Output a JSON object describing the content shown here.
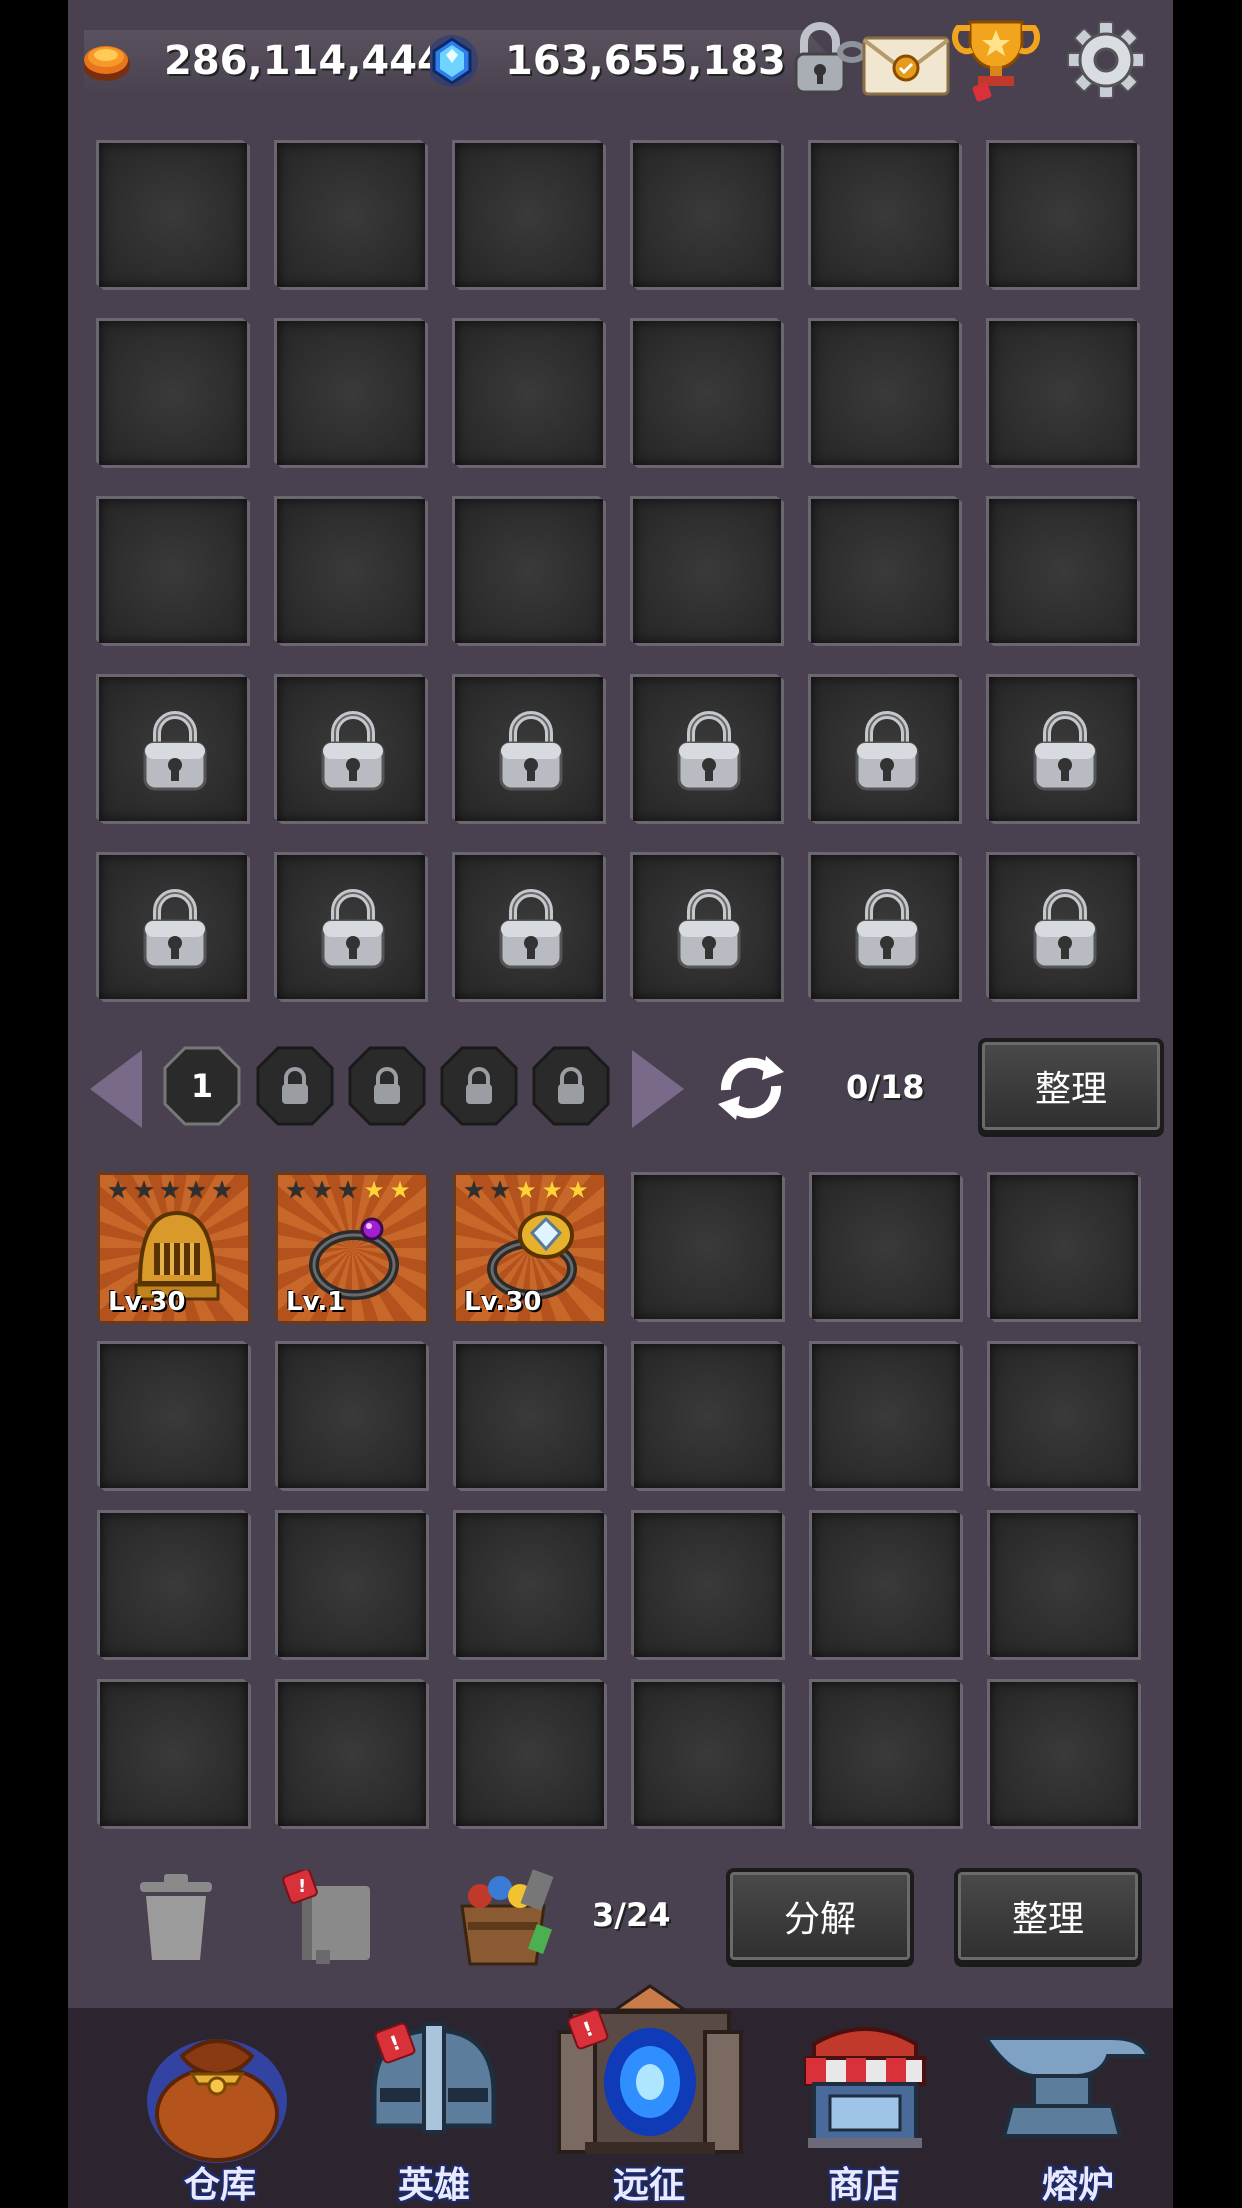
{
  "resources": {
    "gold": "286,114,444",
    "gems": "163,655,183"
  },
  "top_icons": [
    "lock-chain-icon",
    "mail-icon",
    "trophy-icon",
    "gear-icon"
  ],
  "pagination": {
    "current_page": "1",
    "locked_pages": 4,
    "count": "0/18",
    "sort_label": "整理"
  },
  "items": [
    {
      "name": "golden-helmet",
      "level": "Lv.30",
      "stars": 0,
      "total_stars": 5
    },
    {
      "name": "purple-gem-ring",
      "level": "Lv.1",
      "stars": 2,
      "total_stars": 5
    },
    {
      "name": "diamond-gold-ring",
      "level": "Lv.30",
      "stars": 3,
      "total_stars": 5
    }
  ],
  "bag": {
    "count": "3/24",
    "decompose_label": "分解",
    "sort_label": "整理"
  },
  "nav": [
    {
      "id": "warehouse",
      "label": "仓库",
      "badge": ""
    },
    {
      "id": "heroes",
      "label": "英雄",
      "badge": "!"
    },
    {
      "id": "expedition",
      "label": "远征",
      "badge": "!"
    },
    {
      "id": "shop",
      "label": "商店",
      "badge": ""
    },
    {
      "id": "furnace",
      "label": "熔炉",
      "badge": ""
    }
  ],
  "colors": {
    "background": "#4a4150",
    "slot": "#2b2b2b",
    "nav_bar": "#2c2530",
    "star_on": "#ffd23a",
    "badge": "#d8313a"
  }
}
